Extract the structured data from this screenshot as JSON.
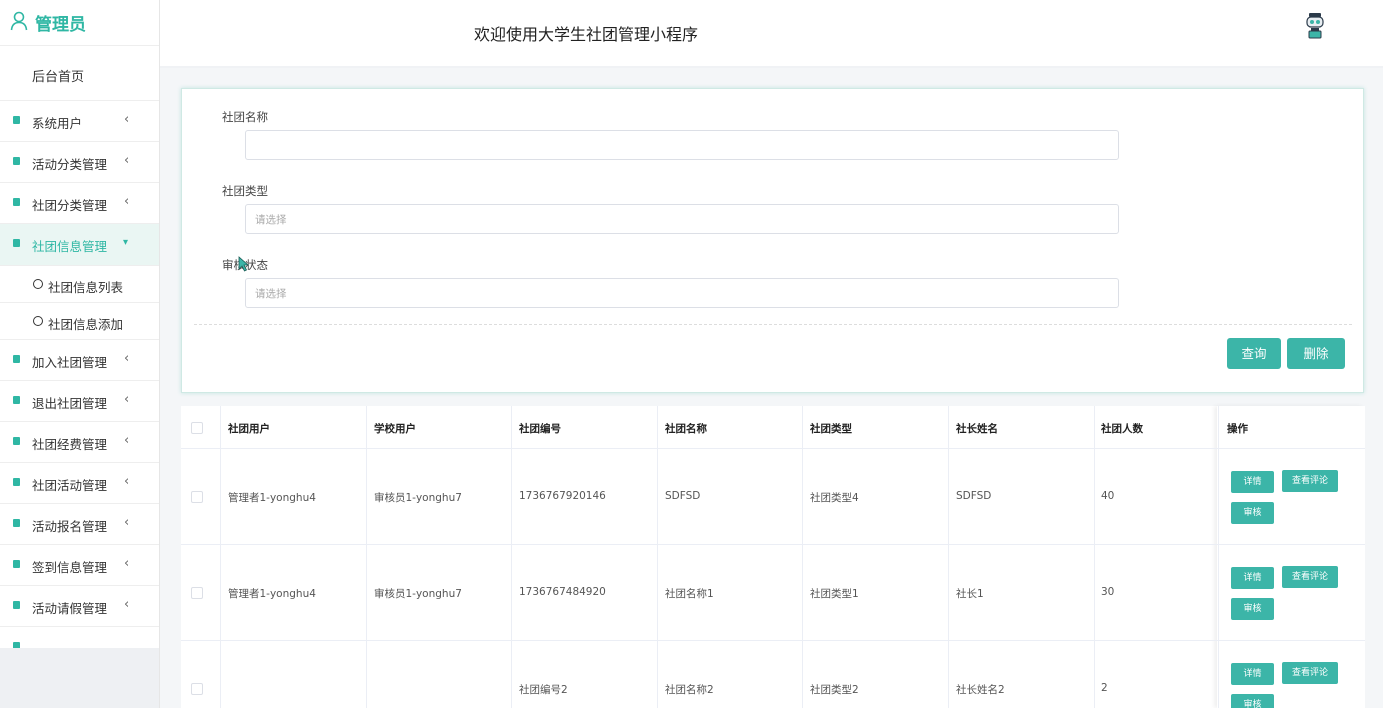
{
  "sidebar": {
    "brand": "管理员",
    "home": "后台首页",
    "items": [
      {
        "label": "系统用户"
      },
      {
        "label": "活动分类管理"
      },
      {
        "label": "社团分类管理"
      },
      {
        "label": "社团信息管理"
      },
      {
        "label": "加入社团管理"
      },
      {
        "label": "退出社团管理"
      },
      {
        "label": "社团经费管理"
      },
      {
        "label": "社团活动管理"
      },
      {
        "label": "活动报名管理"
      },
      {
        "label": "签到信息管理"
      },
      {
        "label": "活动请假管理"
      }
    ],
    "sub_items": [
      {
        "label": "社团信息列表"
      },
      {
        "label": "社团信息添加"
      }
    ]
  },
  "header": {
    "title": "欢迎使用大学生社团管理小程序"
  },
  "search": {
    "name_label": "社团名称",
    "name_value": "",
    "type_label": "社团类型",
    "type_placeholder": "请选择",
    "status_label": "审核状态",
    "status_placeholder": "请选择",
    "query_label": "查询",
    "delete_label": "删除"
  },
  "table": {
    "columns": [
      "社团用户",
      "学校用户",
      "社团编号",
      "社团名称",
      "社团类型",
      "社长姓名",
      "社团人数",
      "操作"
    ],
    "rows": [
      {
        "club_user": "管理者1-yonghu4",
        "school_user": "审核员1-yonghu7",
        "club_no": "1736767920146",
        "club_name": "SDFSD",
        "club_type": "社团类型4",
        "leader": "SDFSD",
        "members": "40"
      },
      {
        "club_user": "管理者1-yonghu4",
        "school_user": "审核员1-yonghu7",
        "club_no": "1736767484920",
        "club_name": "社团名称1",
        "club_type": "社团类型1",
        "leader": "社长1",
        "members": "30"
      },
      {
        "club_user": "",
        "school_user": "",
        "club_no": "社团编号2",
        "club_name": "社团名称2",
        "club_type": "社团类型2",
        "leader": "社长姓名2",
        "members": "2"
      }
    ],
    "actions": {
      "detail": "详情",
      "review_comments": "查看评论",
      "audit": "审核"
    }
  },
  "colors": {
    "accent": "#2fb7a4",
    "button": "#3cb5a8"
  }
}
